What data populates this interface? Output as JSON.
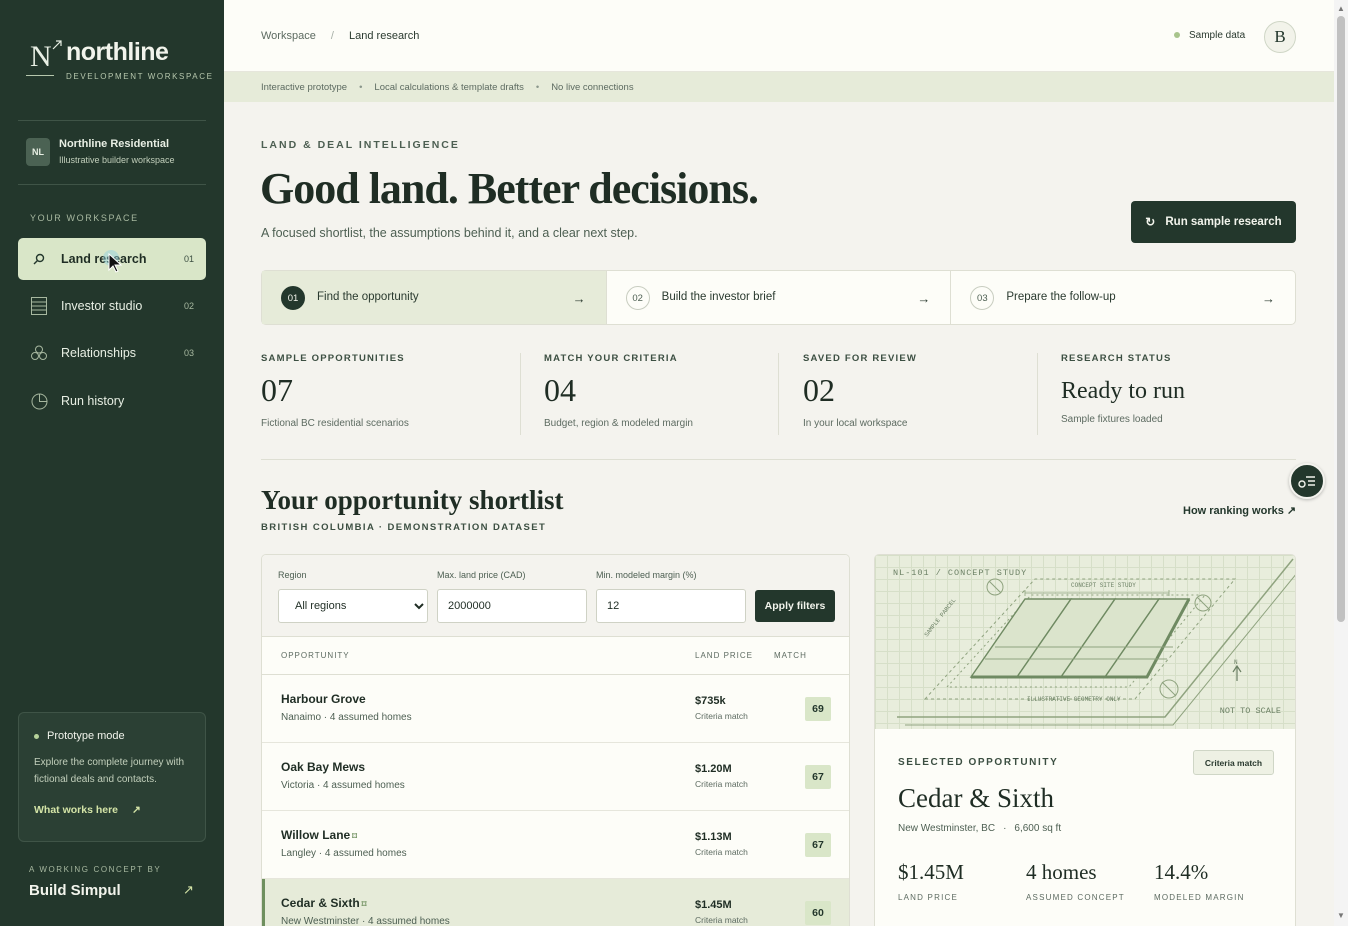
{
  "brand": {
    "mark": "N",
    "name": "northline",
    "tagline": "DEVELOPMENT WORKSPACE"
  },
  "org": {
    "initials": "NL",
    "name": "Northline Residential",
    "subtitle": "Illustrative builder workspace"
  },
  "sidebar": {
    "section_label": "YOUR WORKSPACE",
    "items": [
      {
        "label": "Land research",
        "num": "01",
        "icon": "search-icon",
        "active": true
      },
      {
        "label": "Investor studio",
        "num": "02",
        "icon": "document-icon",
        "active": false
      },
      {
        "label": "Relationships",
        "num": "03",
        "icon": "people-icon",
        "active": false
      },
      {
        "label": "Run history",
        "num": "",
        "icon": "clock-icon",
        "active": false
      }
    ]
  },
  "prototype": {
    "title": "Prototype mode",
    "text": "Explore the complete journey with fictional deals and contacts.",
    "link": "What works here",
    "link_arrow": "↗"
  },
  "credit": {
    "label": "A WORKING CONCEPT BY",
    "name": "Build Simpul",
    "arrow": "↗"
  },
  "breadcrumb": {
    "root": "Workspace",
    "separator": "/",
    "current": "Land research"
  },
  "header": {
    "status": "Sample data",
    "avatar_initial": "B"
  },
  "infobar": {
    "items": [
      "Interactive prototype",
      "Local calculations & template drafts",
      "No live connections"
    ],
    "separator": "•"
  },
  "hero": {
    "eyebrow": "LAND & DEAL INTELLIGENCE",
    "title": "Good land. Better decisions.",
    "subtitle": "A focused shortlist, the assumptions behind it, and a clear next step.",
    "button": "Run sample research",
    "button_icon": "↻"
  },
  "steps": [
    {
      "num": "01",
      "label": "Find the opportunity",
      "arrow": "→",
      "active": true
    },
    {
      "num": "02",
      "label": "Build the investor brief",
      "arrow": "→",
      "active": false
    },
    {
      "num": "03",
      "label": "Prepare the follow-up",
      "arrow": "→",
      "active": false
    }
  ],
  "stats": [
    {
      "label": "SAMPLE OPPORTUNITIES",
      "value": "07",
      "note": "Fictional BC residential scenarios"
    },
    {
      "label": "MATCH YOUR CRITERIA",
      "value": "04",
      "note": "Budget, region & modeled margin"
    },
    {
      "label": "SAVED FOR REVIEW",
      "value": "02",
      "note": "In your local workspace"
    },
    {
      "label": "RESEARCH STATUS",
      "value": "Ready to run",
      "note": "Sample fixtures loaded"
    }
  ],
  "shortlist": {
    "title": "Your opportunity shortlist",
    "subtitle": "BRITISH COLUMBIA · DEMONSTRATION DATASET",
    "how_link": "How ranking works ↗"
  },
  "filters": {
    "region_label": "Region",
    "region_value": "All regions",
    "price_label": "Max. land price (CAD)",
    "price_value": "2000000",
    "margin_label": "Min. modeled margin (%)",
    "margin_value": "12",
    "apply": "Apply filters"
  },
  "table": {
    "headers": {
      "opportunity": "OPPORTUNITY",
      "price": "LAND PRICE",
      "match": "MATCH"
    },
    "rows": [
      {
        "name": "Harbour Grove",
        "sub": "Nanaimo · 4 assumed homes",
        "price": "$735k",
        "match_label": "Criteria match",
        "score": "69",
        "flag": ""
      },
      {
        "name": "Oak Bay Mews",
        "sub": "Victoria · 4 assumed homes",
        "price": "$1.20M",
        "match_label": "Criteria match",
        "score": "67",
        "flag": ""
      },
      {
        "name": "Willow Lane",
        "sub": "Langley · 4 assumed homes",
        "price": "$1.13M",
        "match_label": "Criteria match",
        "score": "67",
        "flag": "⌑"
      },
      {
        "name": "Cedar & Sixth",
        "sub": "New Westminster · 4 assumed homes",
        "price": "$1.45M",
        "match_label": "Criteria match",
        "score": "60",
        "flag": "⌑"
      }
    ]
  },
  "selected": {
    "plan_tag": "NL-101 / CONCEPT STUDY",
    "plan_study": "CONCEPT SITE STUDY",
    "plan_parcel": "SAMPLE PARCEL",
    "plan_geometry": "ILLUSTRATIVE GEOMETRY ONLY",
    "plan_north": "N",
    "plan_scale": "NOT TO SCALE",
    "label": "SELECTED OPPORTUNITY",
    "badge": "Criteria match",
    "title": "Cedar & Sixth",
    "location": "New Westminster, BC",
    "area": "6,600 sq ft",
    "metrics": [
      {
        "value": "$1.45M",
        "label": "LAND PRICE"
      },
      {
        "value": "4 homes",
        "label": "ASSUMED CONCEPT"
      },
      {
        "value": "14.4%",
        "label": "MODELED MARGIN"
      }
    ]
  },
  "colors": {
    "sidebar": "#23372c",
    "accent": "#d9e6c8",
    "background": "#f4f3ee"
  }
}
